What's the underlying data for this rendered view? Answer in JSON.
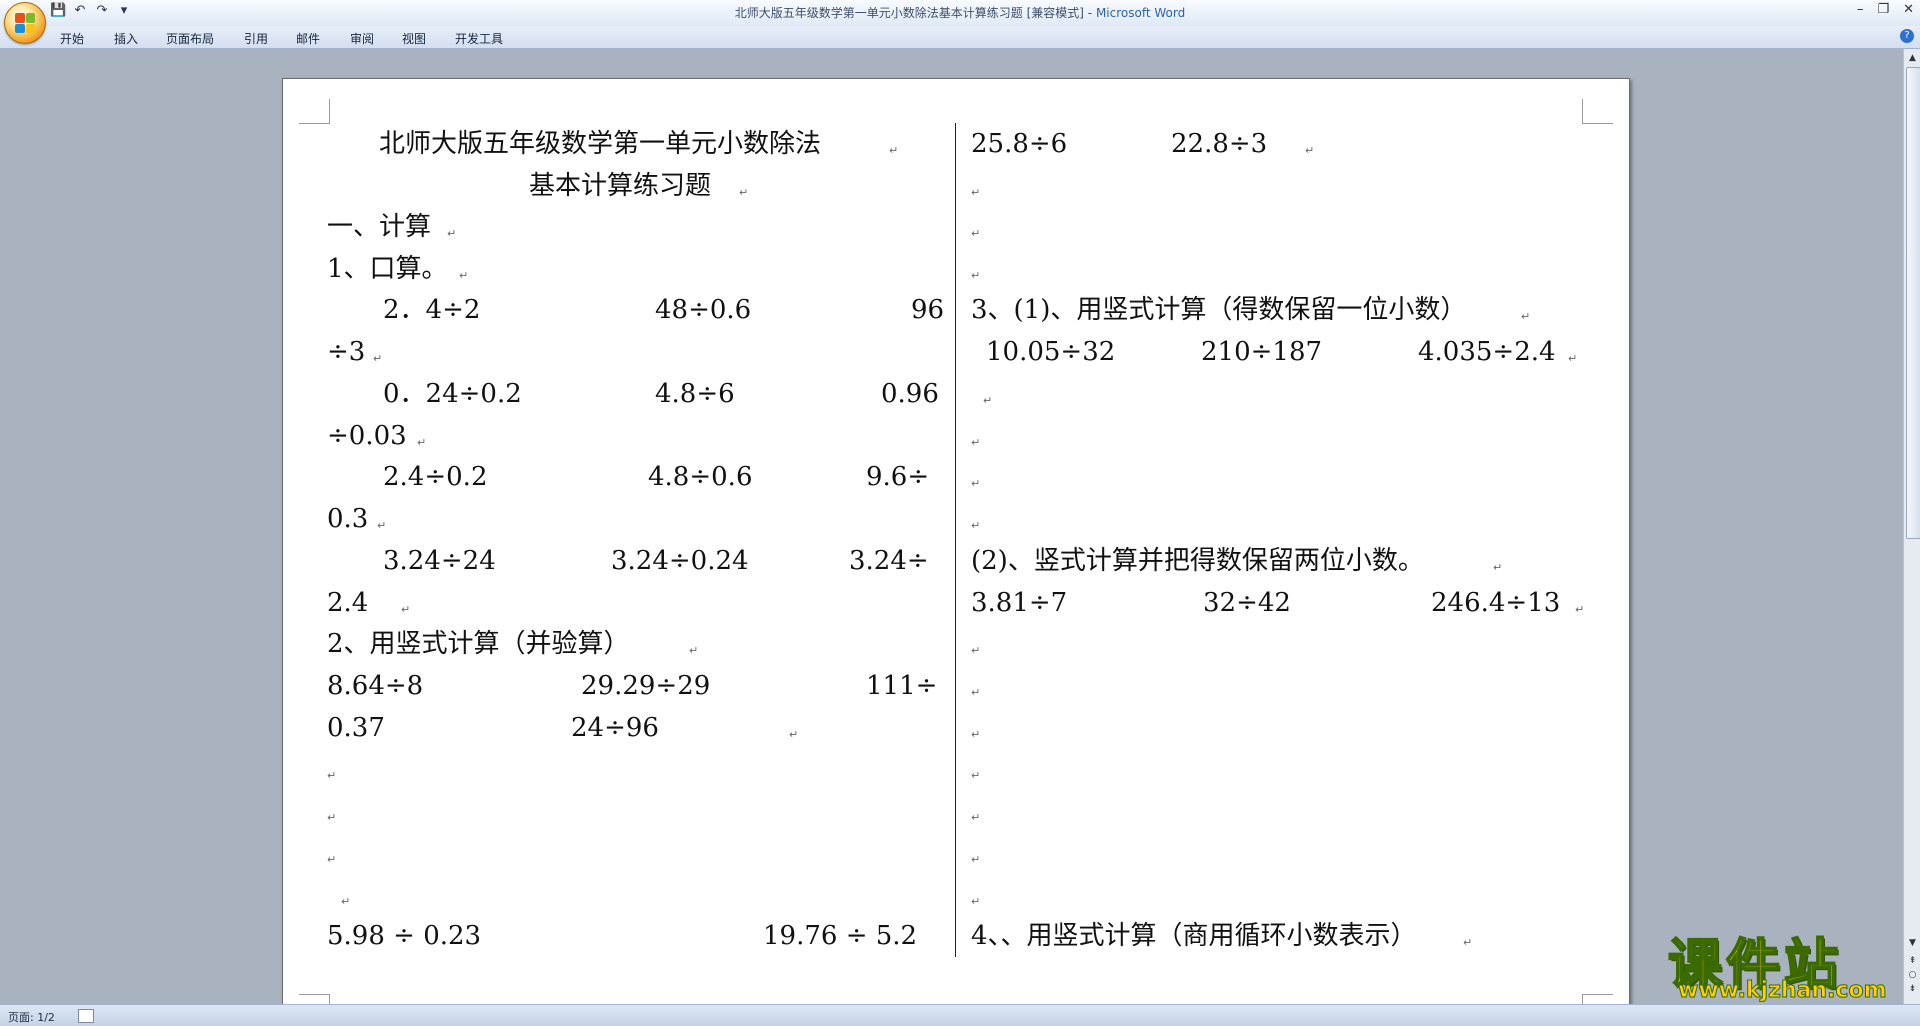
{
  "window": {
    "title": "北师大版五年级数学第一单元小数除法基本计算练习题 [兼容模式]",
    "title_sep": " - ",
    "app_name": "Microsoft Word",
    "controls": [
      "–",
      "❐",
      "✕"
    ]
  },
  "quick_access": {
    "save_icon": "save-icon",
    "undo_icon": "undo-icon",
    "redo_icon": "redo-icon",
    "customize_glyph": "▾"
  },
  "ribbon_tabs": [
    "开始",
    "插入",
    "页面布局",
    "引用",
    "邮件",
    "审阅",
    "视图",
    "开发工具"
  ],
  "help_glyph": "?",
  "paragraph_mark": "↵",
  "left_column": {
    "title_line1": "北师大版五年级数学第一单元小数除法",
    "title_line2": "基本计算练习题",
    "section1": "一、计算",
    "q1": "1、口算。",
    "r1": [
      "2．4÷2",
      "48÷0.6",
      "96"
    ],
    "r1_wrap": "÷3",
    "r2": [
      "0．24÷0.2",
      "4.8÷6",
      "0.96"
    ],
    "r2_wrap": "÷0.03",
    "r3": [
      "2.4÷0.2",
      "4.8÷0.6",
      "9.6÷"
    ],
    "r3_wrap": "0.3",
    "r4": [
      "3.24÷24",
      "3.24÷0.24",
      "3.24÷"
    ],
    "r4_wrap": "2.4",
    "q2": "2、用竖式计算（并验算）",
    "r5": [
      "8.64÷8",
      "29.29÷29",
      "111÷"
    ],
    "r5_wrap": [
      "0.37",
      "24÷96"
    ],
    "r6": [
      "5.98 ÷ 0.23",
      "19.76 ÷ 5.2"
    ]
  },
  "right_column": {
    "r1": [
      "25.8÷6",
      "22.8÷3"
    ],
    "q3": "3、(1)、用竖式计算（得数保留一位小数）",
    "r2": [
      "10.05÷32",
      "210÷187",
      "4.035÷2.4"
    ],
    "q3b": "(2)、竖式计算并把得数保留两位小数。",
    "r3": [
      "3.81÷7",
      "32÷42",
      "246.4÷13"
    ],
    "q4": "4、、用竖式计算（商用循环小数表示）"
  },
  "status": {
    "page": "页面: 1/2"
  },
  "watermark": {
    "main": "课件站",
    "url": "www.kjzhan.com"
  }
}
